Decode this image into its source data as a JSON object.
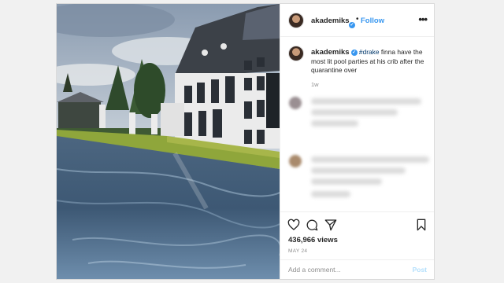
{
  "header": {
    "username": "akademiks",
    "separator": "•",
    "follow_label": "Follow",
    "more_label": "•••"
  },
  "caption": {
    "username": "akademiks",
    "hashtag": "#drake",
    "text": " finna have the most lit pool parties at his crib after the quarantine over",
    "time": "1w"
  },
  "actions": {
    "views": "436,966 views",
    "date": "MAY 24",
    "like_icon": "heart-icon",
    "comment_icon": "comment-bubble-icon",
    "share_icon": "paper-plane-icon",
    "save_icon": "bookmark-icon"
  },
  "comment_box": {
    "placeholder": "Add a comment...",
    "post_label": "Post"
  },
  "colors": {
    "link": "#3897f0",
    "post_disabled": "#b2dffc",
    "text": "#262626",
    "muted": "#8e8e8e"
  }
}
